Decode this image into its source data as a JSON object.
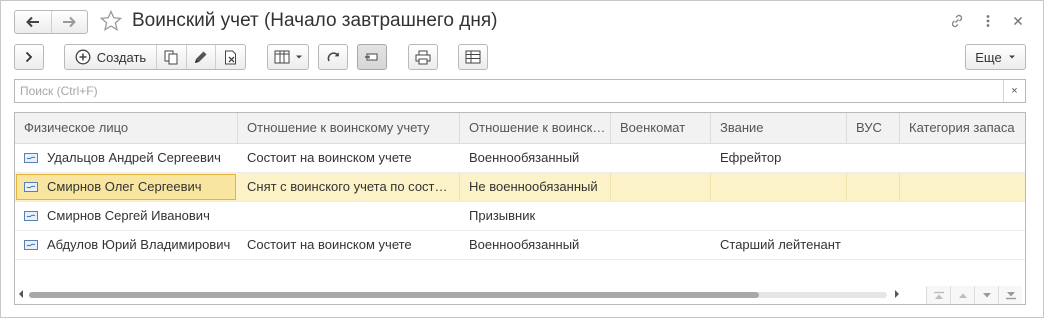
{
  "window": {
    "title": "Воинский учет (Начало завтрашнего дня)"
  },
  "toolbar": {
    "create_label": "Создать",
    "more_label": "Еще"
  },
  "search": {
    "placeholder": "Поиск (Ctrl+F)",
    "value": "",
    "clear_label": "×"
  },
  "table": {
    "columns": [
      "Физическое лицо",
      "Отношение к воинскому учету",
      "Отношение к воинск…",
      "Военкомат",
      "Звание",
      "ВУС",
      "Категория запаса"
    ],
    "rows": [
      {
        "name": "Удальцов Андрей Сергеевич",
        "relation": "Состоит на воинском учете",
        "obligation": "Военнообязанный",
        "enlistment_office": "",
        "rank": "Ефрейтор",
        "vus": "",
        "reserve_category": ""
      },
      {
        "name": "Смирнов Олег Сергеевич",
        "relation": "Снят с воинского учета по сост…",
        "obligation": "Не военнообязанный",
        "enlistment_office": "",
        "rank": "",
        "vus": "",
        "reserve_category": "",
        "selected": true
      },
      {
        "name": "Смирнов Сергей Иванович",
        "relation": "",
        "obligation": "Призывник",
        "enlistment_office": "",
        "rank": "",
        "vus": "",
        "reserve_category": ""
      },
      {
        "name": "Абдулов Юрий Владимирович",
        "relation": "Состоит на воинском учете",
        "obligation": "Военнообязанный",
        "enlistment_office": "",
        "rank": "Старший лейтенант",
        "vus": "",
        "reserve_category": ""
      }
    ]
  },
  "scrollbar": {
    "horizontal_position": 0.85
  },
  "colors": {
    "selection": "#fbf2c8",
    "focus_border": "#e2b53a",
    "border": "#b9b9b9"
  },
  "icons": {
    "back": "arrow-left-icon",
    "forward": "arrow-right-icon",
    "favorite": "star-icon",
    "link": "link-icon",
    "menu": "more-vertical-icon",
    "close": "close-icon",
    "expand": "chevron-right-icon",
    "create": "plus-circle-icon",
    "copy": "copy-icon",
    "edit": "pencil-icon",
    "delete": "delete-mark-icon",
    "columns": "columns-icon",
    "refresh": "refresh-icon",
    "details": "details-panel-icon",
    "print": "printer-icon",
    "table_settings": "table-settings-icon",
    "row": "person-card-icon"
  }
}
